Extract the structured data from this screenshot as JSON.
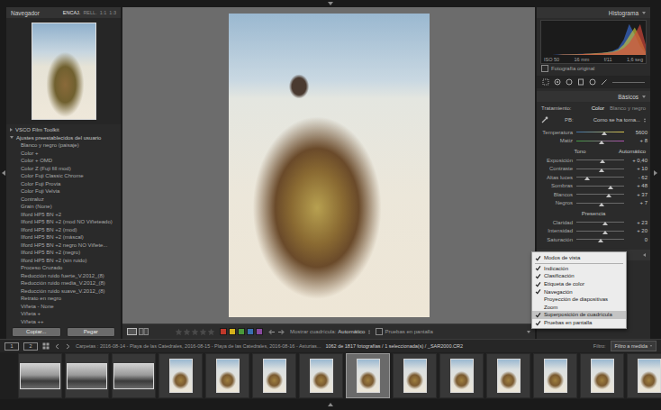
{
  "navigator": {
    "title": "Navegador",
    "zoom_options": [
      {
        "label": "ENCAJ.",
        "selected": true
      },
      {
        "label": "RELL.",
        "selected": false
      },
      {
        "label": "1:1",
        "selected": false
      },
      {
        "label": "1:3",
        "selected": false
      }
    ]
  },
  "presets": {
    "groups": [
      {
        "label": "VSCO Film Toolkit",
        "expanded": false
      },
      {
        "label": "Ajustes preestablecidos del usuario",
        "expanded": true
      }
    ],
    "items": [
      "Blanco y negro (paisaje)",
      "Color +",
      "Color + OMD",
      "Color Z (Fuji fill mod)",
      "Color Fuji Classic Chrome",
      "Color Fuji Provia",
      "Color Fuji Velvia",
      "Contraluz",
      "Grain (None)",
      "Ilford HP5 BN +2",
      "Ilford HP5 BN +2 (mod NO Viñeteado)",
      "Ilford HP5 BN +2 (mod)",
      "Ilford HP5 BN +2 (máscal)",
      "Ilford HP5 BN +2 negro NO Viñete...",
      "Ilford HP5 BN +2 (negro)",
      "Ilford HP5 BN +2 (sin ruido)",
      "Proceso Cruzado",
      "Reducción ruido fuerte_V.2012_(8)",
      "Reducción ruido media_V.2012_(8)",
      "Reducción ruido suave_V.2012_(8)",
      "Retrato en negro",
      "Viñeta - None",
      "Viñeta +",
      "Viñeta ++"
    ]
  },
  "left_buttons": [
    "Copiar...",
    "Pegar"
  ],
  "toolbar": {
    "stars": 0,
    "color_labels": [
      {
        "color": "#c0392b"
      },
      {
        "color": "#d4b11c"
      },
      {
        "color": "#4a9a3a"
      },
      {
        "color": "#3a6fb0"
      },
      {
        "color": "#8a4aa0"
      }
    ],
    "grid_label": "Mostrar cuadrícula:",
    "grid_value": "Automático",
    "soft_proof": {
      "label": "Pruebas en pantalla",
      "checked": false
    }
  },
  "histogram": {
    "title": "Histograma",
    "channels": [
      {
        "name": "blue",
        "color": "#3a6fd8",
        "values": [
          0,
          0,
          0,
          1,
          1,
          2,
          2,
          3,
          3,
          4,
          5,
          6,
          8,
          12,
          20,
          45,
          90,
          60,
          25,
          5
        ]
      },
      {
        "name": "green",
        "color": "#c8c83a",
        "values": [
          0,
          0,
          0,
          0,
          1,
          1,
          2,
          2,
          3,
          4,
          5,
          6,
          8,
          10,
          15,
          30,
          55,
          80,
          50,
          10
        ]
      },
      {
        "name": "red",
        "color": "#d8483a",
        "values": [
          0,
          0,
          0,
          0,
          1,
          1,
          1,
          2,
          3,
          3,
          4,
          5,
          6,
          8,
          12,
          20,
          35,
          60,
          90,
          30
        ]
      }
    ],
    "readouts": [
      "ISO 50",
      "16 mm",
      "f/11",
      "1,6 seg"
    ],
    "original_photo": {
      "label": "Fotografía original",
      "checked": false
    }
  },
  "basics": {
    "title": "Básicos",
    "treatment": {
      "label": "Tratamiento:",
      "options": [
        {
          "label": "Color",
          "selected": true
        },
        {
          "label": "Blanco y negro",
          "selected": false
        }
      ]
    },
    "wb": {
      "label": "PB:",
      "value": "Como se ha toma..."
    },
    "wb_sliders": [
      {
        "label": "Temperatura",
        "value": "5600",
        "level": 0.58,
        "kind": "temperature"
      },
      {
        "label": "Matiz",
        "value": "+ 8",
        "level": 0.52,
        "kind": "tint"
      }
    ],
    "tone": {
      "label": "Tono",
      "auto": "Automático",
      "sliders": [
        {
          "label": "Exposición",
          "value": "+ 0,40",
          "level": 0.54
        },
        {
          "label": "Contraste",
          "value": "+ 10",
          "level": 0.53
        },
        {
          "label": "Altas luces",
          "value": "- 62",
          "level": 0.22
        },
        {
          "label": "Sombras",
          "value": "+ 48",
          "level": 0.72
        },
        {
          "label": "Blancos",
          "value": "+ 37",
          "level": 0.68
        },
        {
          "label": "Negros",
          "value": "+ 7",
          "level": 0.53
        }
      ]
    },
    "presence": {
      "label": "Presencia",
      "sliders": [
        {
          "label": "Claridad",
          "value": "+ 23",
          "level": 0.6
        },
        {
          "label": "Intensidad",
          "value": "+ 20",
          "level": 0.6
        },
        {
          "label": "Saturación",
          "value": "0",
          "level": 0.5
        }
      ]
    }
  },
  "view_menu": {
    "items": [
      {
        "label": "Modos de vista",
        "checked": true,
        "selected": false,
        "separator_after": true
      },
      {
        "label": "Indicación",
        "checked": true,
        "selected": false,
        "separator_after": false
      },
      {
        "label": "Clasificación",
        "checked": true,
        "selected": false,
        "separator_after": false
      },
      {
        "label": "Etiqueta de color",
        "checked": true,
        "selected": false,
        "separator_after": false
      },
      {
        "label": "Navegación",
        "checked": true,
        "selected": false,
        "separator_after": false
      },
      {
        "label": "Proyección de diapositivas",
        "checked": false,
        "selected": false,
        "separator_after": false
      },
      {
        "label": "Zoom",
        "checked": false,
        "selected": false,
        "separator_after": false
      },
      {
        "label": "Superposición de cuadrícula",
        "checked": true,
        "selected": true,
        "separator_after": false
      },
      {
        "label": "Pruebas en pantalla",
        "checked": true,
        "selected": false,
        "separator_after": false
      }
    ]
  },
  "filmstrip_bar": {
    "pages": [
      "1",
      "2"
    ],
    "path": "Carpetas : 2016-08-14 - Playa de las Catedrales, 2016-08-15 - Playa de las Catedrales, 2016-08-16 - Asturias...",
    "count": "1062 de 1817 fotografías / 1 seleccionada(s) / _SAR2000.CR2",
    "filter_label": "Filtro:",
    "filter_value": "Filtro a medida"
  },
  "filmstrip": {
    "thumbs": [
      {
        "kind": "landscape",
        "selected": false
      },
      {
        "kind": "landscape",
        "selected": false
      },
      {
        "kind": "landscape",
        "selected": false
      },
      {
        "kind": "portrait",
        "selected": false
      },
      {
        "kind": "portrait",
        "selected": false
      },
      {
        "kind": "portrait",
        "selected": false
      },
      {
        "kind": "portrait",
        "selected": false
      },
      {
        "kind": "portrait",
        "selected": true
      },
      {
        "kind": "portrait",
        "selected": false
      },
      {
        "kind": "portrait",
        "selected": false
      },
      {
        "kind": "portrait",
        "selected": false
      },
      {
        "kind": "portrait",
        "selected": false
      },
      {
        "kind": "portrait",
        "selected": false
      },
      {
        "kind": "portrait",
        "selected": false
      }
    ]
  }
}
